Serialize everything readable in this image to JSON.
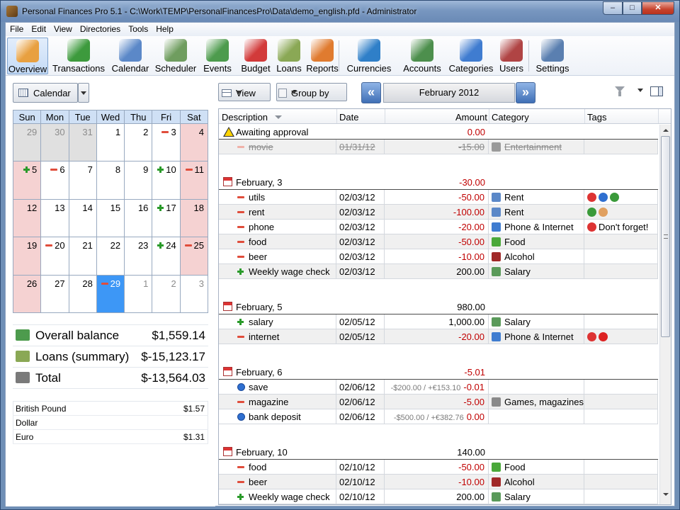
{
  "window": {
    "title": "Personal Finances Pro 5.1 - C:\\Work\\TEMP\\PersonalFinancesPro\\Data\\demo_english.pfd - Administrator"
  },
  "menu": [
    "File",
    "Edit",
    "View",
    "Directories",
    "Tools",
    "Help"
  ],
  "toolbar": [
    {
      "label": "Overview",
      "icon": "overview-icon",
      "color": "#e8a040"
    },
    {
      "label": "Transactions",
      "icon": "transactions-icon",
      "color": "#3d9a3d"
    },
    {
      "label": "Calendar",
      "icon": "calendar-icon",
      "color": "#5b88c8"
    },
    {
      "label": "Scheduler",
      "icon": "scheduler-icon",
      "color": "#6f9d5f"
    },
    {
      "label": "Events",
      "icon": "events-icon",
      "color": "#4d9b4d"
    },
    {
      "label": "Budget",
      "icon": "budget-icon",
      "color": "#d23a3a"
    },
    {
      "label": "Loans",
      "icon": "loans-icon",
      "color": "#8aa855"
    },
    {
      "label": "Reports",
      "icon": "reports-icon",
      "color": "#e07b2f"
    },
    {
      "label": "Currencies",
      "icon": "currencies-icon",
      "color": "#2f7fc8"
    },
    {
      "label": "Accounts",
      "icon": "accounts-icon",
      "color": "#4d8f4d"
    },
    {
      "label": "Categories",
      "icon": "categories-icon",
      "color": "#3f7cd0"
    },
    {
      "label": "Users",
      "icon": "users-icon",
      "color": "#b04444"
    },
    {
      "label": "Settings",
      "icon": "settings-icon",
      "color": "#5a7fb0"
    }
  ],
  "calendar": {
    "button": "Calendar",
    "weekdays": [
      "Sun",
      "Mon",
      "Tue",
      "Wed",
      "Thu",
      "Fri",
      "Sat"
    ],
    "cells": [
      {
        "d": "29",
        "om": true,
        "gray": true
      },
      {
        "d": "30",
        "om": true,
        "gray": true
      },
      {
        "d": "31",
        "om": true,
        "gray": true
      },
      {
        "d": "1"
      },
      {
        "d": "2"
      },
      {
        "d": "3",
        "m": "minus"
      },
      {
        "d": "4",
        "wk": true
      },
      {
        "d": "5",
        "m": "plus",
        "wk": true
      },
      {
        "d": "6",
        "m": "minus"
      },
      {
        "d": "7"
      },
      {
        "d": "8"
      },
      {
        "d": "9"
      },
      {
        "d": "10",
        "m": "plus"
      },
      {
        "d": "11",
        "m": "minus",
        "wk": true
      },
      {
        "d": "12",
        "wk": true
      },
      {
        "d": "13"
      },
      {
        "d": "14"
      },
      {
        "d": "15"
      },
      {
        "d": "16"
      },
      {
        "d": "17",
        "m": "plus"
      },
      {
        "d": "18",
        "wk": true
      },
      {
        "d": "19",
        "wk": true
      },
      {
        "d": "20",
        "m": "minus"
      },
      {
        "d": "21"
      },
      {
        "d": "22"
      },
      {
        "d": "23"
      },
      {
        "d": "24",
        "m": "plus"
      },
      {
        "d": "25",
        "m": "minus",
        "wk": true
      },
      {
        "d": "26",
        "wk": true
      },
      {
        "d": "27"
      },
      {
        "d": "28"
      },
      {
        "d": "29",
        "m": "minus",
        "today": true
      },
      {
        "d": "1",
        "om": true
      },
      {
        "d": "2",
        "om": true
      },
      {
        "d": "3",
        "om": true
      }
    ]
  },
  "summary": [
    {
      "label": "Overall balance",
      "value": "$1,559.14",
      "color": "#4d9b4d"
    },
    {
      "label": "Loans (summary)",
      "value": "$-15,123.17",
      "color": "#8aa855"
    },
    {
      "label": "Total",
      "value": "$-13,564.03",
      "color": "#7a7a7a"
    }
  ],
  "rates": [
    {
      "name": "British Pound",
      "value": "$1.57"
    },
    {
      "name": "Dollar",
      "value": ""
    },
    {
      "name": "Euro",
      "value": "$1.31"
    }
  ],
  "controls": {
    "view": "View",
    "group_by": "Group by",
    "month": "February 2012"
  },
  "columns": {
    "description": "Description",
    "date": "Date",
    "amount": "Amount",
    "category": "Category",
    "tags": "Tags"
  },
  "groups": [
    {
      "title": "Awaiting approval",
      "total": "0.00",
      "warn": true,
      "rows": [
        {
          "desc": "movie",
          "date": "01/31/12",
          "amount": "-15.00",
          "category": "Entertainment",
          "cat_color": "#9a9a9a",
          "strike": true,
          "mark": "minus-pale",
          "alt": true,
          "tags": []
        }
      ]
    },
    {
      "title": "February, 3",
      "total": "-30.00",
      "rows": [
        {
          "desc": "utils",
          "date": "02/03/12",
          "amount": "-50.00",
          "category": "Rent",
          "cat_color": "#5b88c8",
          "mark": "minus",
          "tags": [
            {
              "icon": "pin-icon",
              "color": "#d33"
            },
            {
              "icon": "help-icon",
              "color": "#2f6fd0"
            },
            {
              "icon": "flag-icon",
              "color": "#3a9a3a"
            }
          ]
        },
        {
          "desc": "rent",
          "date": "02/03/12",
          "amount": "-100.00",
          "category": "Rent",
          "cat_color": "#5b88c8",
          "mark": "minus",
          "alt": true,
          "tags": [
            {
              "icon": "check-icon",
              "color": "#3a9a3a"
            },
            {
              "icon": "thumbs-up-icon",
              "color": "#e0a060"
            }
          ]
        },
        {
          "desc": "phone",
          "date": "02/03/12",
          "amount": "-20.00",
          "category": "Phone & Internet",
          "cat_color": "#3f7cd0",
          "mark": "minus",
          "tags": [
            {
              "icon": "pin-icon",
              "color": "#d33"
            }
          ],
          "tag_text": "Don't forget!"
        },
        {
          "desc": "food",
          "date": "02/03/12",
          "amount": "-50.00",
          "category": "Food",
          "cat_color": "#4aa83a",
          "mark": "minus",
          "alt": true,
          "tags": []
        },
        {
          "desc": "beer",
          "date": "02/03/12",
          "amount": "-10.00",
          "category": "Alcohol",
          "cat_color": "#a02828",
          "mark": "minus",
          "tags": []
        },
        {
          "desc": "Weekly wage check",
          "date": "02/03/12",
          "amount": "200.00",
          "category": "Salary",
          "cat_color": "#5a9a5a",
          "mark": "plus",
          "alt": true,
          "tags": []
        }
      ]
    },
    {
      "title": "February, 5",
      "total": "980.00",
      "pos": true,
      "rows": [
        {
          "desc": "salary",
          "date": "02/05/12",
          "amount": "1,000.00",
          "category": "Salary",
          "cat_color": "#5a9a5a",
          "mark": "plus",
          "tags": []
        },
        {
          "desc": "internet",
          "date": "02/05/12",
          "amount": "-20.00",
          "category": "Phone & Internet",
          "cat_color": "#3f7cd0",
          "mark": "minus",
          "alt": true,
          "tags": [
            {
              "icon": "pin-icon",
              "color": "#d33"
            },
            {
              "icon": "alert-icon",
              "color": "#d22"
            }
          ]
        }
      ]
    },
    {
      "title": "February, 6",
      "total": "-5.01",
      "rows": [
        {
          "desc": "save",
          "date": "02/06/12",
          "amount_extra": "-$200.00 / +€153.10",
          "amount": "-0.01",
          "category": "",
          "mark": "transfer",
          "tags": []
        },
        {
          "desc": "magazine",
          "date": "02/06/12",
          "amount": "-5.00",
          "category": "Games, magazines,",
          "cat_color": "#8a8a8a",
          "mark": "minus",
          "alt": true,
          "tags": []
        },
        {
          "desc": "bank deposit",
          "date": "02/06/12",
          "amount_extra": "-$500.00 / +€382.76",
          "amount": "0.00",
          "category": "",
          "mark": "transfer",
          "tags": []
        }
      ]
    },
    {
      "title": "February, 10",
      "total": "140.00",
      "pos": true,
      "rows": [
        {
          "desc": "food",
          "date": "02/10/12",
          "amount": "-50.00",
          "category": "Food",
          "cat_color": "#4aa83a",
          "mark": "minus",
          "tags": []
        },
        {
          "desc": "beer",
          "date": "02/10/12",
          "amount": "-10.00",
          "category": "Alcohol",
          "cat_color": "#a02828",
          "mark": "minus",
          "alt": true,
          "tags": []
        },
        {
          "desc": "Weekly wage check",
          "date": "02/10/12",
          "amount": "200.00",
          "category": "Salary",
          "cat_color": "#5a9a5a",
          "mark": "plus",
          "tags": []
        }
      ]
    }
  ]
}
